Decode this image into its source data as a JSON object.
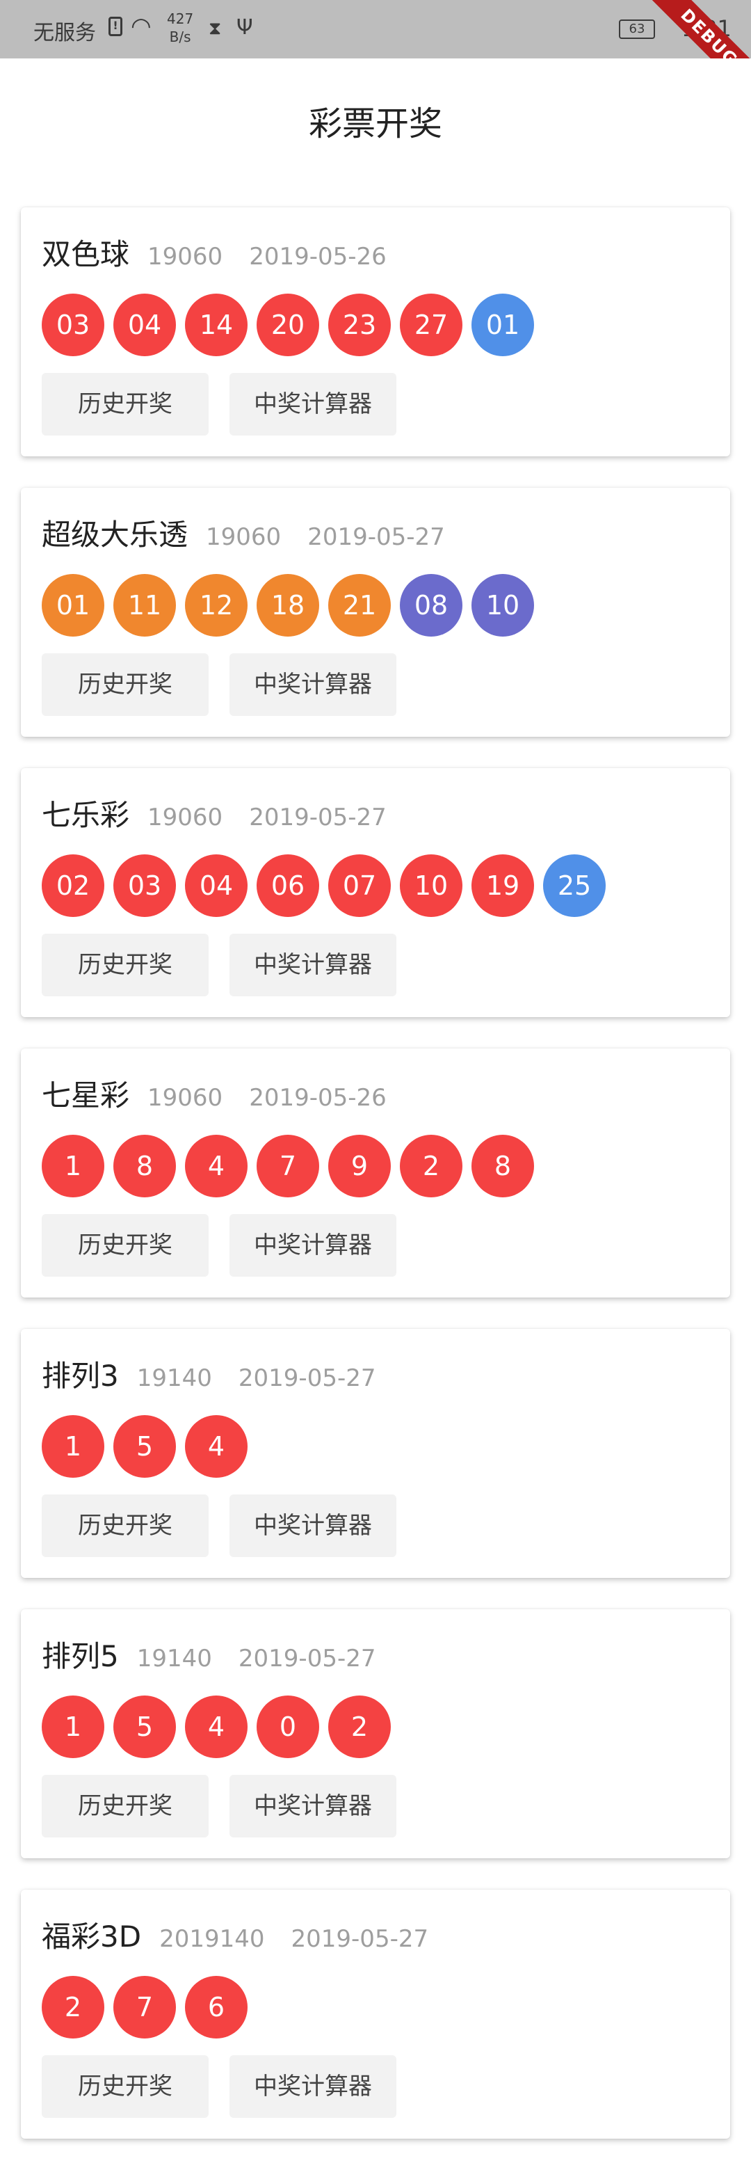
{
  "status_bar": {
    "carrier": "无服务",
    "net_speed_value": "427",
    "net_speed_unit": "B/s",
    "battery": "63",
    "time": "1:31"
  },
  "debug_banner": "DEBUG",
  "app": {
    "title": "彩票开奖"
  },
  "colors": {
    "red": "#f44242",
    "blue": "#5090e8",
    "orange": "#f0872e",
    "purple": "#6b6bcc"
  },
  "lotteries": [
    {
      "name": "双色球",
      "issue": "19060",
      "date": "2019-05-26",
      "balls": [
        {
          "n": "03",
          "c": "red"
        },
        {
          "n": "04",
          "c": "red"
        },
        {
          "n": "14",
          "c": "red"
        },
        {
          "n": "20",
          "c": "red"
        },
        {
          "n": "23",
          "c": "red"
        },
        {
          "n": "27",
          "c": "red"
        },
        {
          "n": "01",
          "c": "blue"
        }
      ],
      "history_label": "历史开奖",
      "calc_label": "中奖计算器"
    },
    {
      "name": "超级大乐透",
      "issue": "19060",
      "date": "2019-05-27",
      "balls": [
        {
          "n": "01",
          "c": "orange"
        },
        {
          "n": "11",
          "c": "orange"
        },
        {
          "n": "12",
          "c": "orange"
        },
        {
          "n": "18",
          "c": "orange"
        },
        {
          "n": "21",
          "c": "orange"
        },
        {
          "n": "08",
          "c": "purple"
        },
        {
          "n": "10",
          "c": "purple"
        }
      ],
      "history_label": "历史开奖",
      "calc_label": "中奖计算器"
    },
    {
      "name": "七乐彩",
      "issue": "19060",
      "date": "2019-05-27",
      "balls": [
        {
          "n": "02",
          "c": "red"
        },
        {
          "n": "03",
          "c": "red"
        },
        {
          "n": "04",
          "c": "red"
        },
        {
          "n": "06",
          "c": "red"
        },
        {
          "n": "07",
          "c": "red"
        },
        {
          "n": "10",
          "c": "red"
        },
        {
          "n": "19",
          "c": "red"
        },
        {
          "n": "25",
          "c": "blue"
        }
      ],
      "history_label": "历史开奖",
      "calc_label": "中奖计算器"
    },
    {
      "name": "七星彩",
      "issue": "19060",
      "date": "2019-05-26",
      "balls": [
        {
          "n": "1",
          "c": "red"
        },
        {
          "n": "8",
          "c": "red"
        },
        {
          "n": "4",
          "c": "red"
        },
        {
          "n": "7",
          "c": "red"
        },
        {
          "n": "9",
          "c": "red"
        },
        {
          "n": "2",
          "c": "red"
        },
        {
          "n": "8",
          "c": "red"
        }
      ],
      "history_label": "历史开奖",
      "calc_label": "中奖计算器"
    },
    {
      "name": "排列3",
      "issue": "19140",
      "date": "2019-05-27",
      "balls": [
        {
          "n": "1",
          "c": "red"
        },
        {
          "n": "5",
          "c": "red"
        },
        {
          "n": "4",
          "c": "red"
        }
      ],
      "history_label": "历史开奖",
      "calc_label": "中奖计算器"
    },
    {
      "name": "排列5",
      "issue": "19140",
      "date": "2019-05-27",
      "balls": [
        {
          "n": "1",
          "c": "red"
        },
        {
          "n": "5",
          "c": "red"
        },
        {
          "n": "4",
          "c": "red"
        },
        {
          "n": "0",
          "c": "red"
        },
        {
          "n": "2",
          "c": "red"
        }
      ],
      "history_label": "历史开奖",
      "calc_label": "中奖计算器"
    },
    {
      "name": "福彩3D",
      "issue": "2019140",
      "date": "2019-05-27",
      "balls": [
        {
          "n": "2",
          "c": "red"
        },
        {
          "n": "7",
          "c": "red"
        },
        {
          "n": "6",
          "c": "red"
        }
      ],
      "history_label": "历史开奖",
      "calc_label": "中奖计算器"
    }
  ]
}
